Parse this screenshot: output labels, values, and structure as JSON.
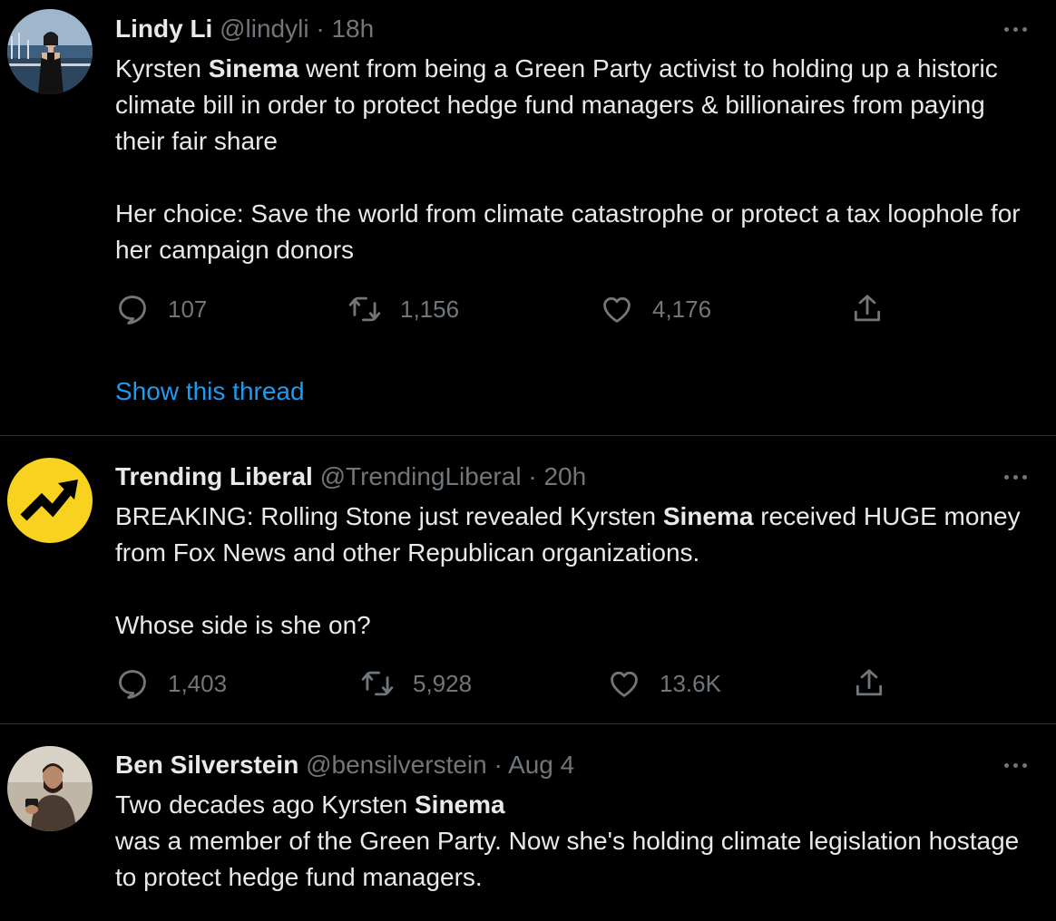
{
  "tweets": [
    {
      "name": "Lindy Li",
      "handle": "@lindyli",
      "separator": "·",
      "time": "18h",
      "paragraphs": [
        [
          {
            "text": "Kyrsten ",
            "bold": false
          },
          {
            "text": "Sinema",
            "bold": true
          },
          {
            "text": " went from being a Green Party activist to holding up a historic climate bill in order to protect hedge fund managers & billionaires from paying their fair share",
            "bold": false
          }
        ],
        [
          {
            "text": "Her choice: Save the world from climate catastrophe or protect a tax loophole for her campaign donors",
            "bold": false
          }
        ]
      ],
      "replies": "107",
      "retweets": "1,156",
      "likes": "4,176",
      "show_thread": "Show this thread"
    },
    {
      "name": "Trending Liberal",
      "handle": "@TrendingLiberal",
      "separator": "·",
      "time": "20h",
      "paragraphs": [
        [
          {
            "text": "BREAKING: Rolling Stone just revealed Kyrsten ",
            "bold": false
          },
          {
            "text": "Sinema",
            "bold": true
          },
          {
            "text": " received HUGE money from Fox News and other Republican organizations.",
            "bold": false
          }
        ],
        [
          {
            "text": "Whose side is she on?",
            "bold": false
          }
        ]
      ],
      "replies": "1,403",
      "retweets": "5,928",
      "likes": "13.6K"
    },
    {
      "name": "Ben Silverstein",
      "handle": "@bensilverstein",
      "separator": "·",
      "time": "Aug 4",
      "paragraphs": [
        [
          {
            "text": "Two decades ago Kyrsten ",
            "bold": false
          },
          {
            "text": "Sinema",
            "bold": true
          }
        ],
        [
          {
            "text": "was a member of the Green Party. Now she's holding climate legislation hostage to protect hedge fund managers.",
            "bold": false
          }
        ]
      ]
    }
  ],
  "colors": {
    "background": "#000000",
    "text": "#e7e9ea",
    "muted": "#71767b",
    "link": "#1d9bf0",
    "divider": "#2f3336",
    "trending_logo_bg": "#f7d31f"
  },
  "icons": {
    "reply": "speech-bubble-icon",
    "retweet": "retweet-arrows-icon",
    "like": "heart-icon",
    "share": "share-upload-icon",
    "more": "more-dots-icon"
  }
}
